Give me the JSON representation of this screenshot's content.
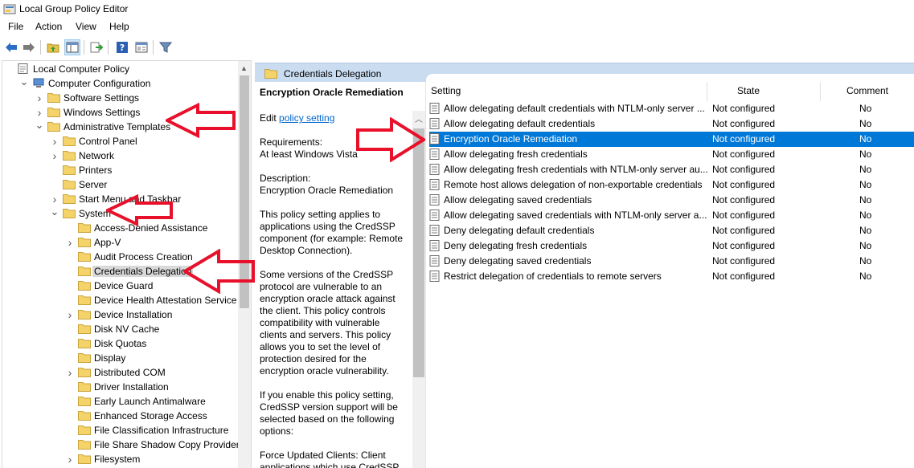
{
  "window": {
    "title": "Local Group Policy Editor"
  },
  "menu": [
    "File",
    "Action",
    "View",
    "Help"
  ],
  "toolbar": {
    "icons": [
      "back-arrow-icon",
      "forward-arrow-icon",
      "up-folder-icon",
      "show-hide-tree-icon",
      "export-list-icon",
      "help-icon",
      "properties-icon",
      "filter-icon"
    ]
  },
  "tree": {
    "items": [
      {
        "label": "Local Computer Policy",
        "level": 0,
        "expander": "",
        "icon": "computer-policy"
      },
      {
        "label": "Computer Configuration",
        "level": 1,
        "expander": "open",
        "icon": "computer"
      },
      {
        "label": "Software Settings",
        "level": 2,
        "expander": "closed",
        "icon": "folder"
      },
      {
        "label": "Windows Settings",
        "level": 2,
        "expander": "closed",
        "icon": "folder"
      },
      {
        "label": "Administrative Templates",
        "level": 2,
        "expander": "open",
        "icon": "folder"
      },
      {
        "label": "Control Panel",
        "level": 3,
        "expander": "closed",
        "icon": "folder"
      },
      {
        "label": "Network",
        "level": 3,
        "expander": "closed",
        "icon": "folder"
      },
      {
        "label": "Printers",
        "level": 3,
        "expander": "",
        "icon": "folder"
      },
      {
        "label": "Server",
        "level": 3,
        "expander": "",
        "icon": "folder"
      },
      {
        "label": "Start Menu and Taskbar",
        "level": 3,
        "expander": "closed",
        "icon": "folder"
      },
      {
        "label": "System",
        "level": 3,
        "expander": "open",
        "icon": "folder"
      },
      {
        "label": "Access-Denied Assistance",
        "level": 4,
        "expander": "",
        "icon": "folder"
      },
      {
        "label": "App-V",
        "level": 4,
        "expander": "closed",
        "icon": "folder"
      },
      {
        "label": "Audit Process Creation",
        "level": 4,
        "expander": "",
        "icon": "folder"
      },
      {
        "label": "Credentials Delegation",
        "level": 4,
        "expander": "",
        "icon": "folder",
        "selected": true
      },
      {
        "label": "Device Guard",
        "level": 4,
        "expander": "",
        "icon": "folder"
      },
      {
        "label": "Device Health Attestation Service",
        "level": 4,
        "expander": "",
        "icon": "folder"
      },
      {
        "label": "Device Installation",
        "level": 4,
        "expander": "closed",
        "icon": "folder"
      },
      {
        "label": "Disk NV Cache",
        "level": 4,
        "expander": "",
        "icon": "folder"
      },
      {
        "label": "Disk Quotas",
        "level": 4,
        "expander": "",
        "icon": "folder"
      },
      {
        "label": "Display",
        "level": 4,
        "expander": "",
        "icon": "folder"
      },
      {
        "label": "Distributed COM",
        "level": 4,
        "expander": "closed",
        "icon": "folder"
      },
      {
        "label": "Driver Installation",
        "level": 4,
        "expander": "",
        "icon": "folder"
      },
      {
        "label": "Early Launch Antimalware",
        "level": 4,
        "expander": "",
        "icon": "folder"
      },
      {
        "label": "Enhanced Storage Access",
        "level": 4,
        "expander": "",
        "icon": "folder"
      },
      {
        "label": "File Classification Infrastructure",
        "level": 4,
        "expander": "",
        "icon": "folder"
      },
      {
        "label": "File Share Shadow Copy Provider",
        "level": 4,
        "expander": "",
        "icon": "folder"
      },
      {
        "label": "Filesystem",
        "level": 4,
        "expander": "closed",
        "icon": "folder"
      }
    ]
  },
  "header": {
    "title": "Credentials Delegation"
  },
  "description": {
    "title": "Encryption Oracle Remediation",
    "edit_prefix": "Edit ",
    "edit_link": "policy setting",
    "requirements_label": "Requirements:",
    "requirements_value": "At least Windows Vista",
    "description_label": "Description:",
    "description_value": "Encryption Oracle Remediation",
    "para1": "This policy setting applies to applications using the CredSSP component (for example: Remote Desktop Connection).",
    "para2": "Some versions of the CredSSP protocol are vulnerable to an encryption oracle attack against the client.  This policy controls compatibility with vulnerable clients and servers.  This policy allows you to set the level of protection desired for the encryption oracle vulnerability.",
    "para3": "If you enable this policy setting, CredSSP version support will be selected based on the following options:",
    "para4": "Force Updated Clients: Client applications which use CredSSP"
  },
  "list": {
    "columns": {
      "setting": "Setting",
      "state": "State",
      "comment": "Comment"
    },
    "rows": [
      {
        "setting": "Allow delegating default credentials with NTLM-only server ...",
        "state": "Not configured",
        "comment": "No"
      },
      {
        "setting": "Allow delegating default credentials",
        "state": "Not configured",
        "comment": "No"
      },
      {
        "setting": "Encryption Oracle Remediation",
        "state": "Not configured",
        "comment": "No",
        "selected": true
      },
      {
        "setting": "Allow delegating fresh credentials",
        "state": "Not configured",
        "comment": "No"
      },
      {
        "setting": "Allow delegating fresh credentials with NTLM-only server au...",
        "state": "Not configured",
        "comment": "No"
      },
      {
        "setting": "Remote host allows delegation of non-exportable credentials",
        "state": "Not configured",
        "comment": "No"
      },
      {
        "setting": "Allow delegating saved credentials",
        "state": "Not configured",
        "comment": "No"
      },
      {
        "setting": "Allow delegating saved credentials with NTLM-only server a...",
        "state": "Not configured",
        "comment": "No"
      },
      {
        "setting": "Deny delegating default credentials",
        "state": "Not configured",
        "comment": "No"
      },
      {
        "setting": "Deny delegating fresh credentials",
        "state": "Not configured",
        "comment": "No"
      },
      {
        "setting": "Deny delegating saved credentials",
        "state": "Not configured",
        "comment": "No"
      },
      {
        "setting": "Restrict delegation of credentials to remote servers",
        "state": "Not configured",
        "comment": "No"
      }
    ]
  },
  "colors": {
    "accent": "#0078d7",
    "header_bg": "#c9dcf0",
    "arrow": "#e8102a",
    "folder": "#f5d36b"
  }
}
